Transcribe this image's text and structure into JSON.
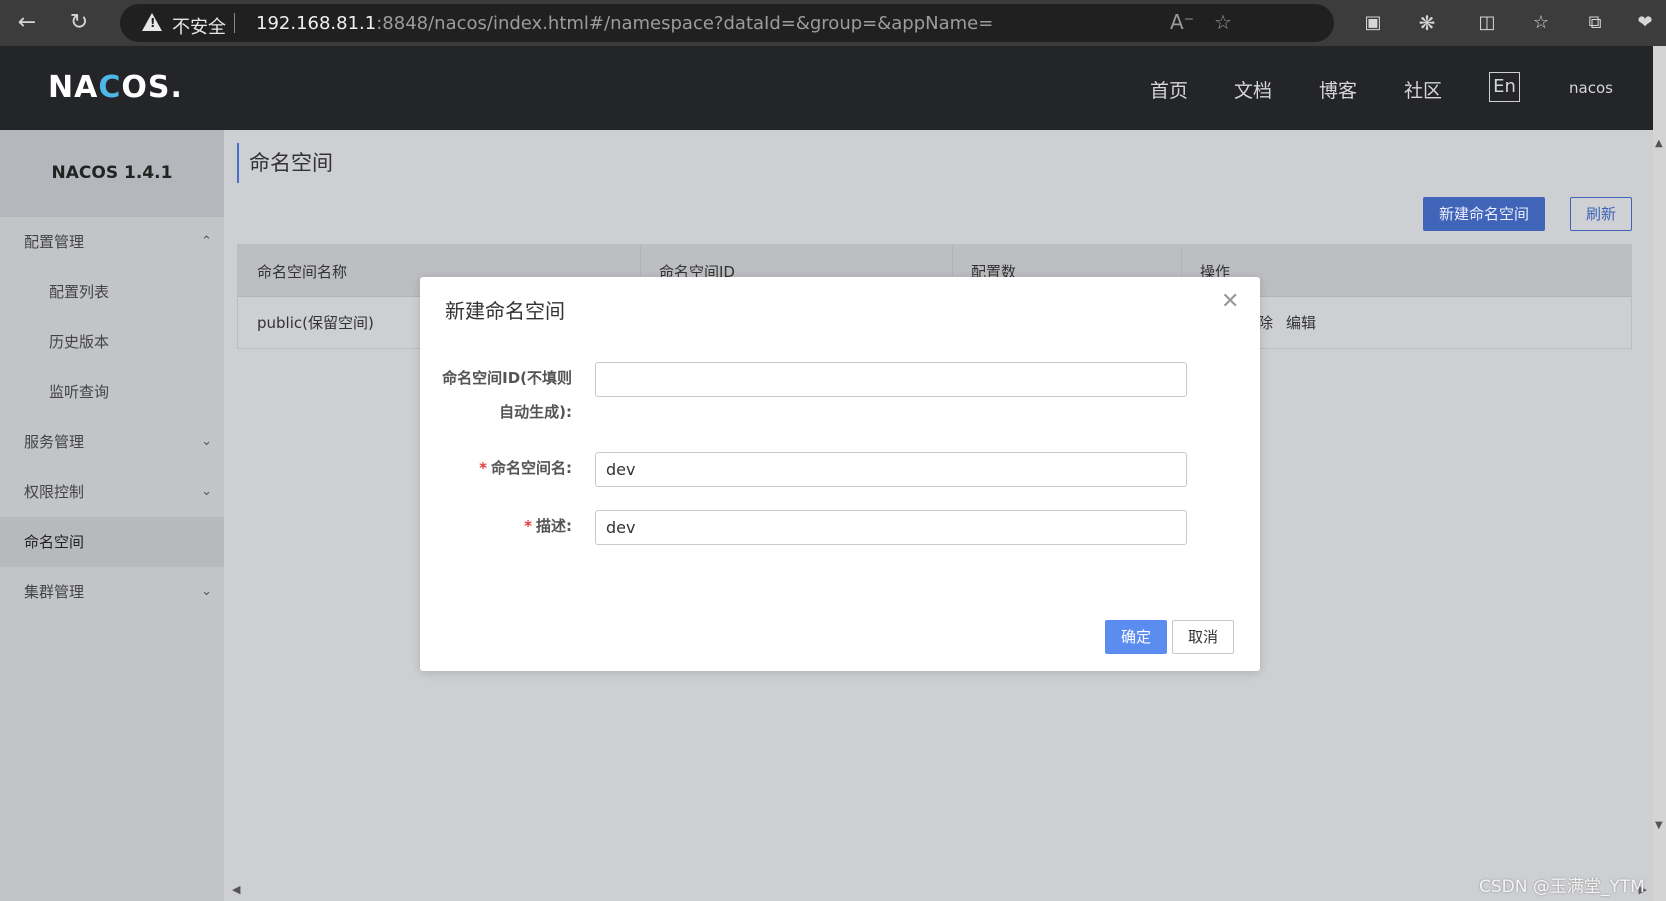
{
  "browser": {
    "security_label": "不安全",
    "url_host": "192.168.81.1",
    "url_rest": ":8848/nacos/index.html#/namespace?dataId=&group=&appName="
  },
  "header": {
    "logo": "NACOS.",
    "nav": [
      "首页",
      "文档",
      "博客",
      "社区"
    ],
    "lang": "En",
    "user": "nacos"
  },
  "sidebar": {
    "version": "NACOS 1.4.1",
    "items": [
      {
        "label": "配置管理"
      },
      {
        "label": "配置列表"
      },
      {
        "label": "历史版本"
      },
      {
        "label": "监听查询"
      },
      {
        "label": "服务管理"
      },
      {
        "label": "权限控制"
      },
      {
        "label": "命名空间"
      },
      {
        "label": "集群管理"
      }
    ]
  },
  "main": {
    "title": "命名空间",
    "new_button": "新建命名空间",
    "refresh_button": "刷新",
    "table": {
      "headers": [
        "命名空间名称",
        "命名空间ID",
        "配置数",
        "操作"
      ],
      "rows": [
        {
          "name": "public(保留空间)",
          "op_delete_partial": "除",
          "op_edit": "编辑"
        }
      ]
    }
  },
  "dialog": {
    "title": "新建命名空间",
    "id_label_line1": "命名空间ID(不填则",
    "id_label_line2": "自动生成):",
    "id_value": "",
    "name_label": "命名空间名:",
    "name_value": "dev",
    "desc_label": "描述:",
    "desc_value": "dev",
    "ok": "确定",
    "cancel": "取消"
  },
  "watermark": "CSDN @玉满堂_YTM"
}
